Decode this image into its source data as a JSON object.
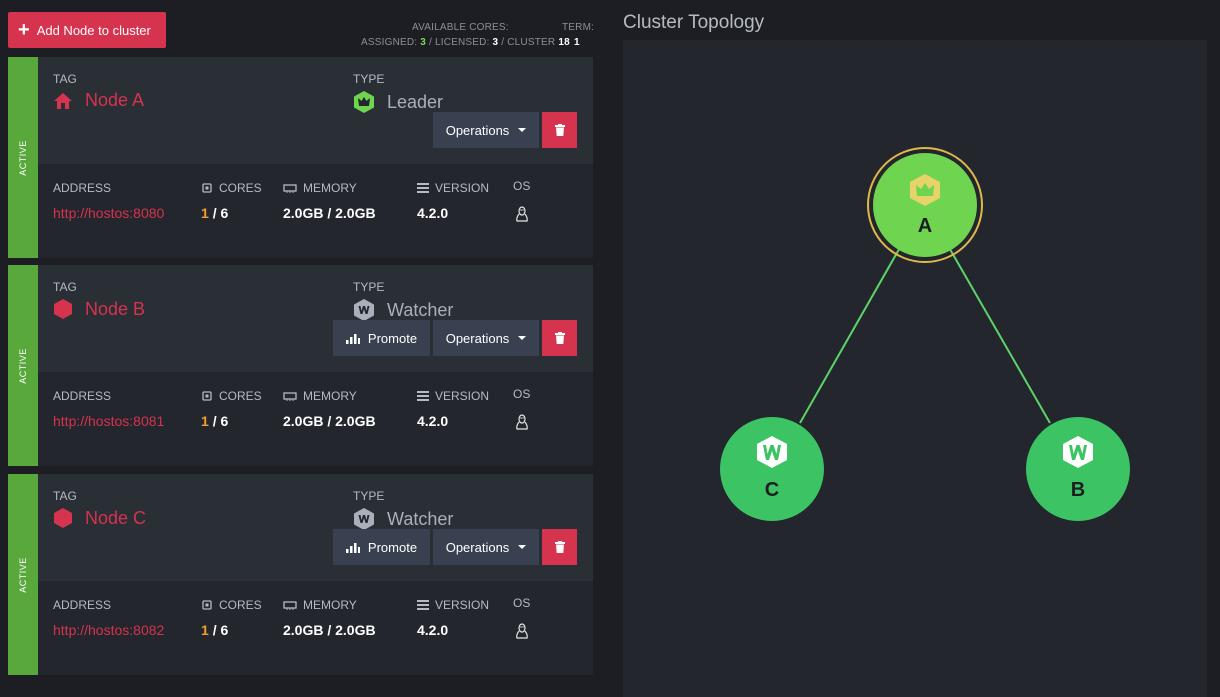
{
  "toolbar": {
    "add_node_label": "Add Node to cluster",
    "available_cores_label": "AVAILABLE CORES:",
    "assigned_label": "ASSIGNED:",
    "assigned_value": "3",
    "licensed_label": "/ LICENSED:",
    "licensed_value": "3",
    "cluster_label": "/ CLUSTER",
    "cluster_value": "18",
    "term_label": "TERM:",
    "term_value": "1"
  },
  "labels": {
    "tag": "TAG",
    "type": "TYPE",
    "address": "ADDRESS",
    "cores": "CORES",
    "memory": "MEMORY",
    "version": "VERSION",
    "os": "OS",
    "operations": "Operations",
    "promote": "Promote",
    "status": "ACTIVE"
  },
  "nodes": [
    {
      "tag": "Node A",
      "type": "Leader",
      "address": "http://hostos:8080",
      "cores_used": "1",
      "cores_total": "/ 6",
      "memory": "2.0GB / 2.0GB",
      "version": "4.2.0",
      "os_icon": "linux-icon"
    },
    {
      "tag": "Node B",
      "type": "Watcher",
      "address": "http://hostos:8081",
      "cores_used": "1",
      "cores_total": "/ 6",
      "memory": "2.0GB / 2.0GB",
      "version": "4.2.0",
      "os_icon": "linux-icon"
    },
    {
      "tag": "Node C",
      "type": "Watcher",
      "address": "http://hostos:8082",
      "cores_used": "1",
      "cores_total": "/ 6",
      "memory": "2.0GB / 2.0GB",
      "version": "4.2.0",
      "os_icon": "linux-icon"
    }
  ],
  "topology": {
    "title": "Cluster Topology",
    "leader_label": "A",
    "watchers": [
      "C",
      "B"
    ]
  },
  "colors": {
    "accent": "#d6334f",
    "active": "#59a83c",
    "leader_node": "#6fd44f",
    "watcher_node": "#3cc464",
    "edge": "#5cd46a"
  }
}
